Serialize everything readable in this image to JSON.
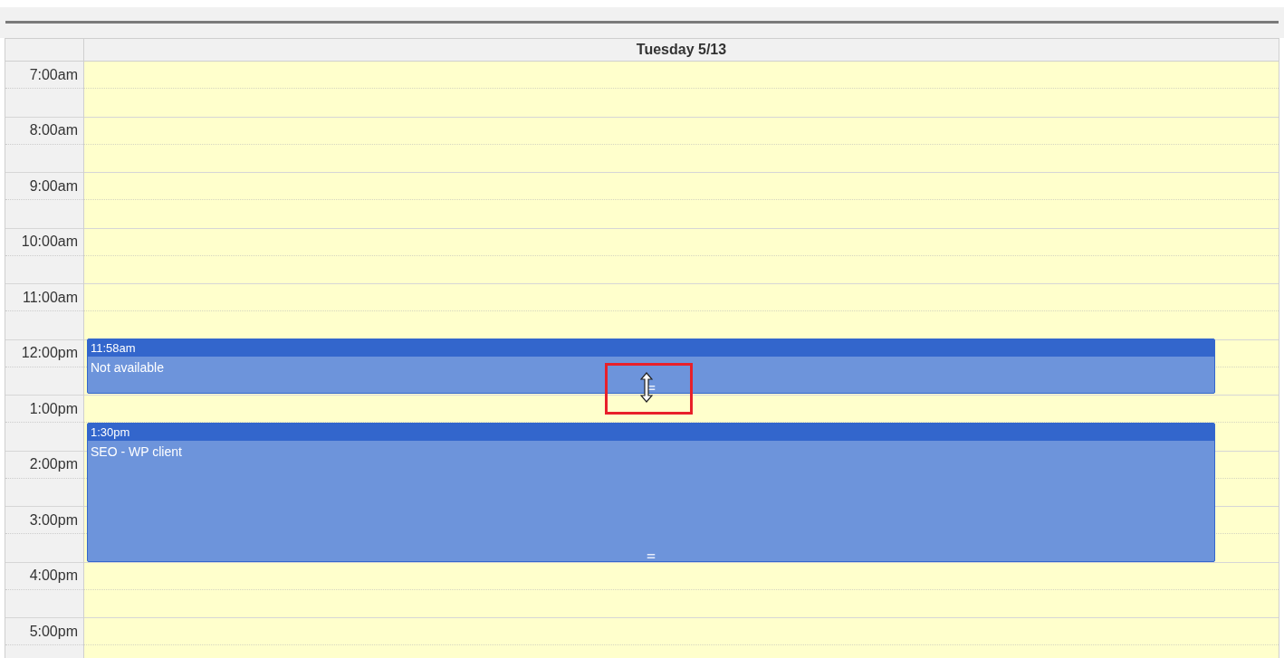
{
  "day_header": "Tuesday 5/13",
  "hours": [
    "7:00am",
    "8:00am",
    "9:00am",
    "10:00am",
    "11:00am",
    "12:00pm",
    "1:00pm",
    "2:00pm",
    "3:00pm",
    "4:00pm",
    "5:00pm"
  ],
  "events": [
    {
      "time": "11:58am",
      "title": "Not available"
    },
    {
      "time": "1:30pm",
      "title": "SEO - WP client"
    }
  ]
}
